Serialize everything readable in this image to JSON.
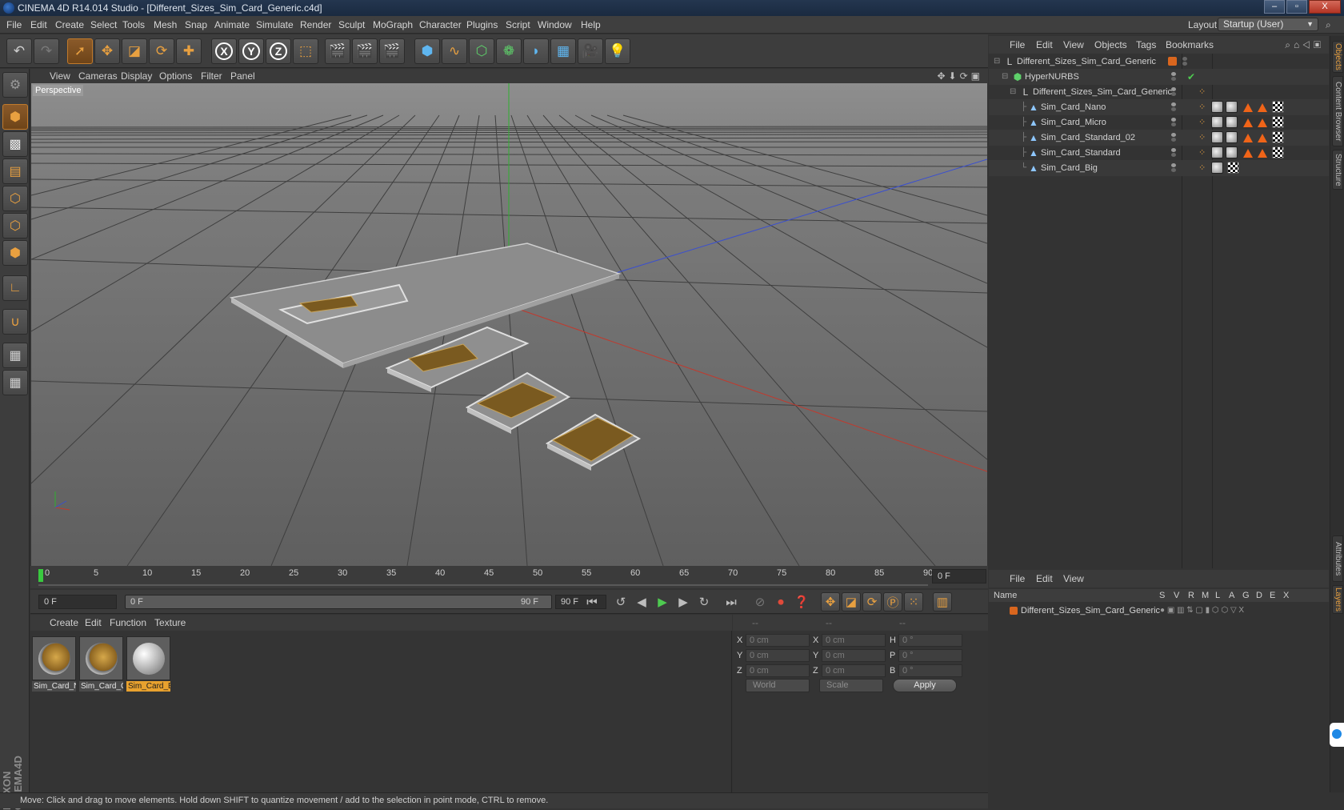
{
  "window": {
    "title": "CINEMA 4D R14.014 Studio - [Different_Sizes_Sim_Card_Generic.c4d]",
    "buttons": [
      "–",
      "▫",
      "X"
    ]
  },
  "menubar": {
    "items": [
      "File",
      "Edit",
      "Create",
      "Select",
      "Tools",
      "Mesh",
      "Snap",
      "Animate",
      "Simulate",
      "Render",
      "Sculpt",
      "MoGraph",
      "Character",
      "Plugins",
      "Script",
      "Window",
      "Help"
    ],
    "layout_label": "Layout:",
    "layout_value": "Startup (User)"
  },
  "viewport": {
    "menu": [
      "View",
      "Cameras",
      "Display",
      "Options",
      "Filter",
      "Panel"
    ],
    "label": "Perspective"
  },
  "timeline": {
    "ticks": [
      "0",
      "5",
      "10",
      "15",
      "20",
      "25",
      "30",
      "35",
      "40",
      "45",
      "50",
      "55",
      "60",
      "65",
      "70",
      "75",
      "80",
      "85",
      "90"
    ],
    "current_frame": "0 F"
  },
  "playback": {
    "start_field": "0 F",
    "range_start": "0 F",
    "range_end": "90 F",
    "end_field": "90 F"
  },
  "materials": {
    "menu": [
      "Create",
      "Edit",
      "Function",
      "Texture"
    ],
    "items": [
      {
        "label": "Sim_Card_N"
      },
      {
        "label": "Sim_Card_C"
      },
      {
        "label": "Sim_Card_B"
      }
    ]
  },
  "coordinates": {
    "headers": [
      "--",
      "--",
      "--"
    ],
    "rows": [
      {
        "a": "X",
        "av": "0 cm",
        "b": "X",
        "bv": "0 cm",
        "c": "H",
        "cv": "0 °"
      },
      {
        "a": "Y",
        "av": "0 cm",
        "b": "Y",
        "bv": "0 cm",
        "c": "P",
        "cv": "0 °"
      },
      {
        "a": "Z",
        "av": "0 cm",
        "b": "Z",
        "bv": "0 cm",
        "c": "B",
        "cv": "0 °"
      }
    ],
    "space": "World",
    "mode": "Scale",
    "apply": "Apply"
  },
  "status": "Move: Click and drag to move elements. Hold down SHIFT to quantize movement / add to the selection in point mode, CTRL to remove.",
  "objects": {
    "menu": [
      "File",
      "Edit",
      "View",
      "Objects",
      "Tags",
      "Bookmarks"
    ],
    "rows": [
      {
        "name": "Different_Sizes_Sim_Card_Generic"
      },
      {
        "name": "HyperNURBS"
      },
      {
        "name": "Different_Sizes_Sim_Card_Generic"
      },
      {
        "name": "Sim_Card_Nano"
      },
      {
        "name": "Sim_Card_Micro"
      },
      {
        "name": "Sim_Card_Standard_02"
      },
      {
        "name": "Sim_Card_Standard"
      },
      {
        "name": "Sim_Card_Big"
      }
    ]
  },
  "layers": {
    "menu": [
      "File",
      "Edit",
      "View"
    ],
    "columns": [
      "Name",
      "S",
      "V",
      "R",
      "M",
      "L",
      "A",
      "G",
      "D",
      "E",
      "X"
    ],
    "row_name": "Different_Sizes_Sim_Card_Generic"
  },
  "side_tabs": [
    "Objects",
    "Content Browser",
    "Structure",
    "Attributes",
    "Layers"
  ],
  "colors": {
    "accent": "#e8a12e",
    "x_axis": "#c03a2e",
    "y_axis": "#2fb02f",
    "z_axis": "#3a4fd0",
    "layer_color": "#d9661e"
  }
}
